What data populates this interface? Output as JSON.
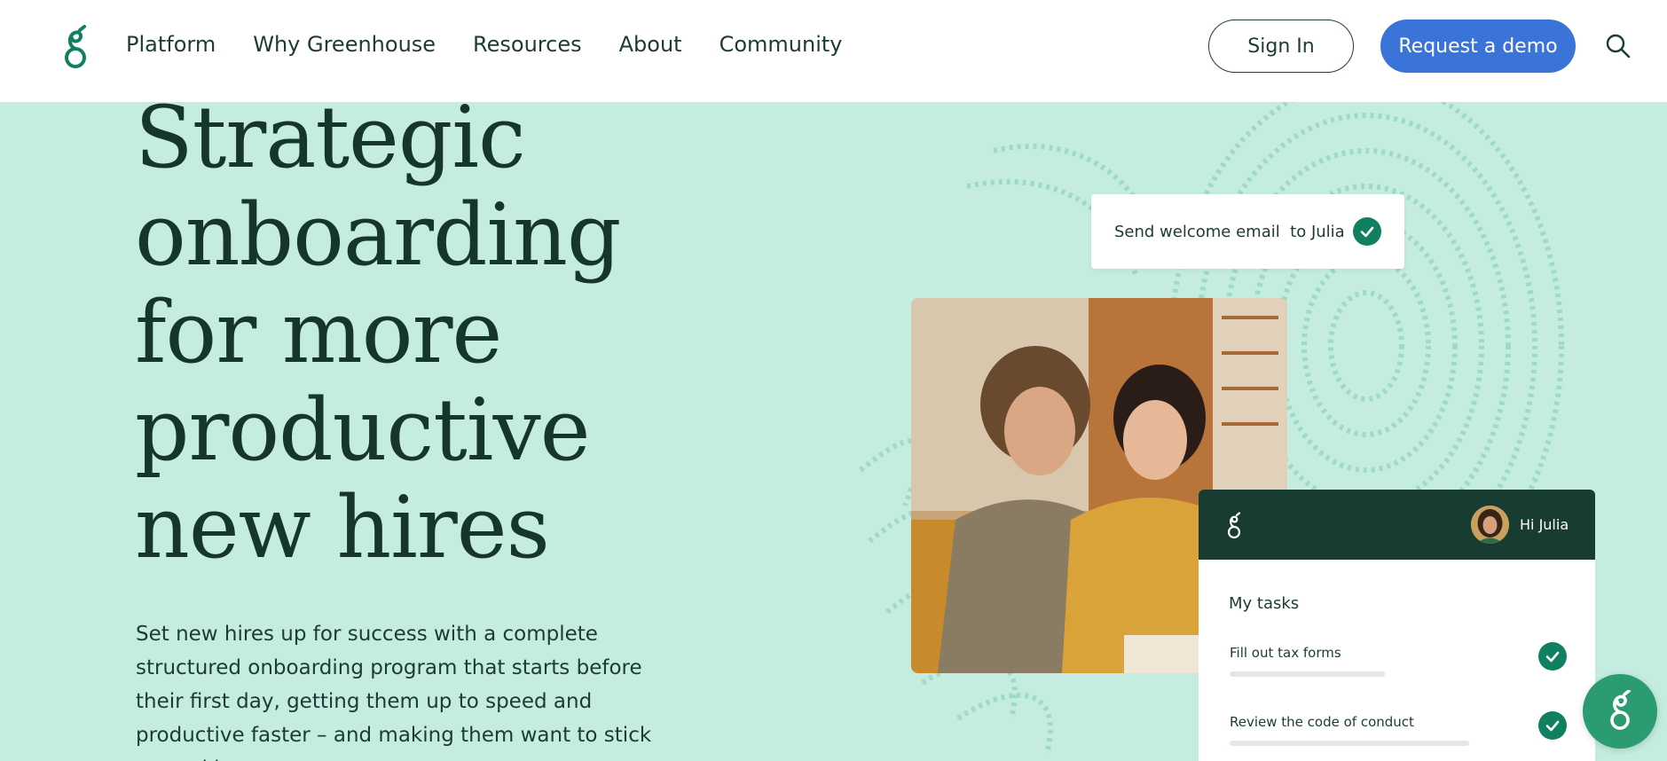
{
  "header": {
    "logo_icon": "greenhouse-g-logo",
    "nav": [
      "Platform",
      "Why Greenhouse",
      "Resources",
      "About",
      "Community"
    ],
    "sign_in": "Sign In",
    "request_demo": "Request a demo",
    "search_icon": "search-icon"
  },
  "hero": {
    "headline_lines": [
      "Strategic",
      "onboarding",
      "for more",
      "productive",
      "new hires"
    ],
    "subtext": "Set new hires up for success with a complete structured onboarding program that starts before their first day, getting them up to speed and productive faster – and making them want to stick around longer."
  },
  "email_card": {
    "text": "Send welcome email  to Julia",
    "status_icon": "check-icon"
  },
  "task_panel": {
    "greeting": "Hi Julia",
    "title": "My tasks",
    "tasks": [
      {
        "label": "Fill out tax forms",
        "done": true
      },
      {
        "label": "Review the code of conduct",
        "done": true
      }
    ]
  },
  "colors": {
    "background": "#c5ece0",
    "headline": "#16362d",
    "brand_blue": "#3a74d9",
    "brand_green": "#108060",
    "panel_dark": "#183c32"
  }
}
